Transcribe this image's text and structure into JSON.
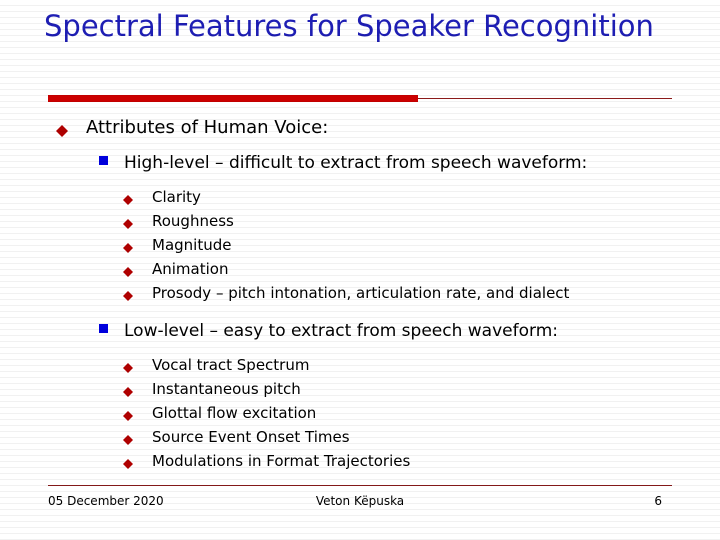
{
  "slide": {
    "title": "Spectral Features for Speaker Recognition",
    "accent_red": "#cc0000",
    "rule_red": "#8b1a1a",
    "title_blue": "#1e1eb4",
    "bullet_red": "#b00000",
    "bullet_blue": "#0000dd",
    "background": "#ffffff"
  },
  "content": {
    "items": [
      {
        "level": 1,
        "bullet": "diamond-red",
        "text": "Attributes of Human Voice:"
      },
      {
        "level": 2,
        "bullet": "square-blue",
        "text": "High-level – difficult to extract from speech waveform:"
      },
      {
        "level": 3,
        "bullet": "diamond-red",
        "text": "Clarity"
      },
      {
        "level": 3,
        "bullet": "diamond-red",
        "text": "Roughness"
      },
      {
        "level": 3,
        "bullet": "diamond-red",
        "text": "Magnitude"
      },
      {
        "level": 3,
        "bullet": "diamond-red",
        "text": "Animation"
      },
      {
        "level": 3,
        "bullet": "diamond-red",
        "text": "Prosody – pitch intonation, articulation rate, and dialect"
      },
      {
        "level": 2,
        "bullet": "square-blue",
        "text": "Low-level – easy to extract from speech waveform:"
      },
      {
        "level": 3,
        "bullet": "diamond-red",
        "text": "Vocal tract Spectrum"
      },
      {
        "level": 3,
        "bullet": "diamond-red",
        "text": "Instantaneous pitch"
      },
      {
        "level": 3,
        "bullet": "diamond-red",
        "text": "Glottal flow excitation"
      },
      {
        "level": 3,
        "bullet": "diamond-red",
        "text": "Source Event Onset Times"
      },
      {
        "level": 3,
        "bullet": "diamond-red",
        "text": "Modulations in Format Trajectories"
      }
    ]
  },
  "footer": {
    "date": "05 December 2020",
    "author": "Veton Këpuska",
    "page_number": "6"
  }
}
